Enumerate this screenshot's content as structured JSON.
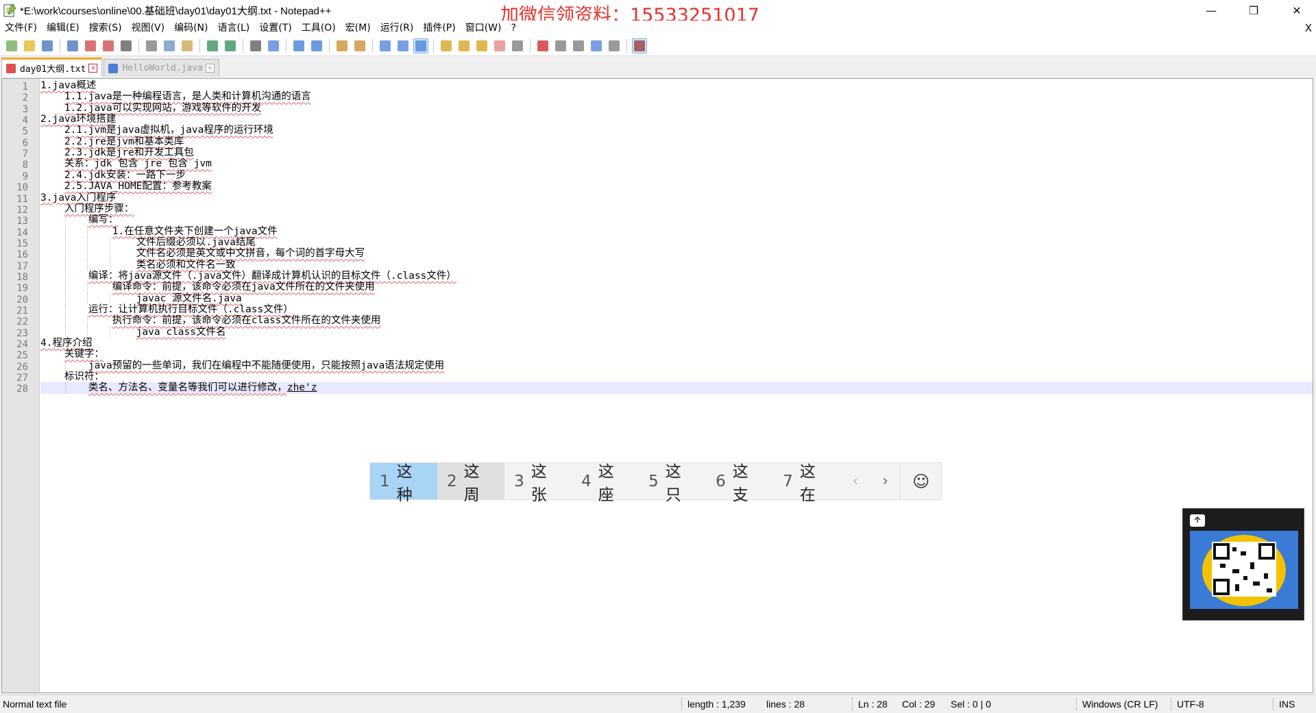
{
  "window": {
    "title": "*E:\\work\\courses\\online\\00.基础班\\day01\\day01大纲.txt - Notepad++",
    "watermark": "加微信领资料：15533251017",
    "controls": {
      "minimize": "—",
      "maximize": "❐",
      "close": "✕"
    }
  },
  "menu": {
    "items": [
      "文件(F)",
      "编辑(E)",
      "搜索(S)",
      "视图(V)",
      "编码(N)",
      "语言(L)",
      "设置(T)",
      "工具(O)",
      "宏(M)",
      "运行(R)",
      "插件(P)",
      "窗口(W)",
      "?"
    ],
    "close_doc": "X"
  },
  "toolbar": {
    "buttons": [
      "new-file",
      "open-file",
      "save",
      "save-all",
      "close",
      "close-all",
      "print",
      "cut",
      "copy",
      "paste",
      "undo",
      "redo",
      "find",
      "replace",
      "zoom-in",
      "zoom-out",
      "sync-vertical",
      "sync-horizontal",
      "word-wrap",
      "show-all-chars",
      "indent-guide",
      "doc-map",
      "function-list",
      "folder-workspace",
      "doc-list",
      "monitoring",
      "record-macro",
      "stop-record",
      "play-macro",
      "run-macro-multiple",
      "save-macro",
      "spell-check"
    ]
  },
  "tabs": [
    {
      "label": "day01大纲.txt",
      "active": true,
      "color": "#e05050"
    },
    {
      "label": "HelloWorld.java",
      "active": false,
      "color": "#4a7fd8"
    }
  ],
  "editor": {
    "lines": [
      {
        "n": "1",
        "indent": 0,
        "text": "1.java概述"
      },
      {
        "n": "2",
        "indent": 4,
        "text": "1.1.java是一种编程语言，是人类和计算机沟通的语言"
      },
      {
        "n": "3",
        "indent": 4,
        "text": "1.2.java可以实现网站，游戏等软件的开发"
      },
      {
        "n": "4",
        "indent": 0,
        "text": "2.java环境搭建"
      },
      {
        "n": "5",
        "indent": 4,
        "text": "2.1.jvm是java虚拟机，java程序的运行环境"
      },
      {
        "n": "6",
        "indent": 4,
        "text": "2.2.jre是jvm和基本类库"
      },
      {
        "n": "7",
        "indent": 4,
        "text": "2.3.jdk是jre和开发工具包"
      },
      {
        "n": "8",
        "indent": 4,
        "text": "关系：jdk 包含 jre 包含 jvm"
      },
      {
        "n": "9",
        "indent": 4,
        "text": "2.4.jdk安装：一路下一步"
      },
      {
        "n": "10",
        "indent": 4,
        "text": "2.5.JAVA_HOME配置：参考教案"
      },
      {
        "n": "11",
        "indent": 0,
        "text": "3.java入门程序"
      },
      {
        "n": "12",
        "indent": 4,
        "text": "入门程序步骤："
      },
      {
        "n": "13",
        "indent": 8,
        "text": "编写："
      },
      {
        "n": "14",
        "indent": 12,
        "text": "1.在任意文件夹下创建一个java文件"
      },
      {
        "n": "15",
        "indent": 16,
        "text": "文件后缀必须以.java结尾"
      },
      {
        "n": "16",
        "indent": 16,
        "text": "文件名必须是英文或中文拼音，每个词的首字母大写"
      },
      {
        "n": "17",
        "indent": 16,
        "text": "类名必须和文件名一致"
      },
      {
        "n": "18",
        "indent": 8,
        "text": "编译：将java源文件（.java文件）翻译成计算机认识的目标文件（.class文件）"
      },
      {
        "n": "19",
        "indent": 12,
        "text": "编译命令：前提，该命令必须在java文件所在的文件夹使用"
      },
      {
        "n": "20",
        "indent": 16,
        "text": "javac 源文件名.java"
      },
      {
        "n": "21",
        "indent": 8,
        "text": "运行：让计算机执行目标文件（.class文件）"
      },
      {
        "n": "22",
        "indent": 12,
        "text": "执行命令：前提，该命令必须在class文件所在的文件夹使用"
      },
      {
        "n": "23",
        "indent": 16,
        "text": "java class文件名"
      },
      {
        "n": "24",
        "indent": 0,
        "text": "4.程序介绍"
      },
      {
        "n": "25",
        "indent": 4,
        "text": "关键字："
      },
      {
        "n": "26",
        "indent": 8,
        "text": "java预留的一些单词，我们在编程中不能随便使用，只能按照java语法规定使用"
      },
      {
        "n": "27",
        "indent": 4,
        "text": "标识符："
      },
      {
        "n": "28",
        "indent": 8,
        "text": "类名、方法名、变量名等我们可以进行修改，",
        "composing": "zhe'z"
      }
    ],
    "current_line": "28"
  },
  "ime": {
    "candidates": [
      {
        "num": "1",
        "text": "这种"
      },
      {
        "num": "2",
        "text": "这周"
      },
      {
        "num": "3",
        "text": "这张"
      },
      {
        "num": "4",
        "text": "这座"
      },
      {
        "num": "5",
        "text": "这只"
      },
      {
        "num": "6",
        "text": "这支"
      },
      {
        "num": "7",
        "text": "这在"
      }
    ],
    "prev": "‹",
    "next": "›",
    "emoji": "☺"
  },
  "status": {
    "file_type": "Normal text file",
    "length": "length : 1,239",
    "lines": "lines : 28",
    "ln": "Ln : 28",
    "col": "Col : 29",
    "sel": "Sel : 0 | 0",
    "eol": "Windows (CR LF)",
    "encoding": "UTF-8",
    "mode": "INS"
  }
}
